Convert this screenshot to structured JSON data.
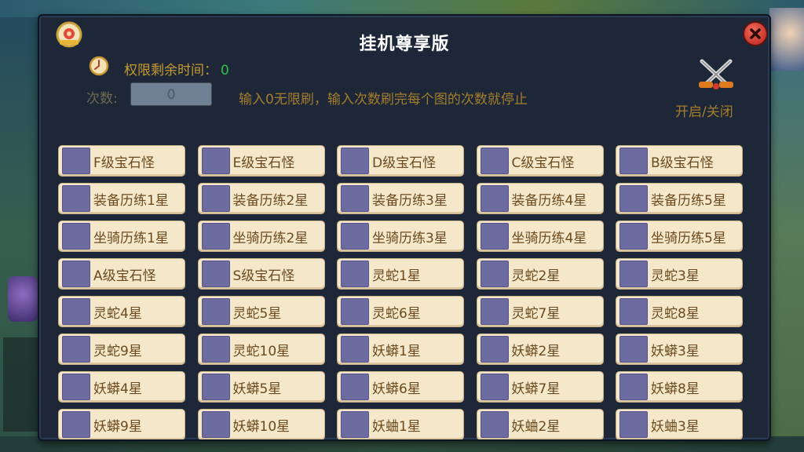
{
  "panel": {
    "title": "挂机尊享版",
    "time_label": "权限剩余时间：",
    "time_value": "0",
    "count_label": "次数:",
    "count_value": "0",
    "hint": "输入0无限刷，输入次数刷完每个图的次数就停止",
    "toggle_label": "开启/关闭"
  },
  "options": [
    "F级宝石怪",
    "E级宝石怪",
    "D级宝石怪",
    "C级宝石怪",
    "B级宝石怪",
    "装备历练1星",
    "装备历练2星",
    "装备历练3星",
    "装备历练4星",
    "装备历练5星",
    "坐骑历练1星",
    "坐骑历练2星",
    "坐骑历练3星",
    "坐骑历练4星",
    "坐骑历练5星",
    "A级宝石怪",
    "S级宝石怪",
    "灵蛇1星",
    "灵蛇2星",
    "灵蛇3星",
    "灵蛇4星",
    "灵蛇5星",
    "灵蛇6星",
    "灵蛇7星",
    "灵蛇8星",
    "灵蛇9星",
    "灵蛇10星",
    "妖蟒1星",
    "妖蟒2星",
    "妖蟒3星",
    "妖蟒4星",
    "妖蟒5星",
    "妖蟒6星",
    "妖蟒7星",
    "妖蟒8星",
    "妖蟒9星",
    "妖蟒10星",
    "妖蛐1星",
    "妖蛐2星",
    "妖蛐3星"
  ],
  "icons": {
    "logo": "scroll-emblem-icon",
    "close": "close-icon",
    "clock": "clock-icon",
    "toggle": "crossed-swords-icon"
  },
  "colors": {
    "panel_bg": "#1d2738",
    "cell_bg": "#f5e7c9",
    "checkbox": "#6d6ca1",
    "accent_gold": "#c69a2e",
    "timer_green": "#2fc04a"
  }
}
